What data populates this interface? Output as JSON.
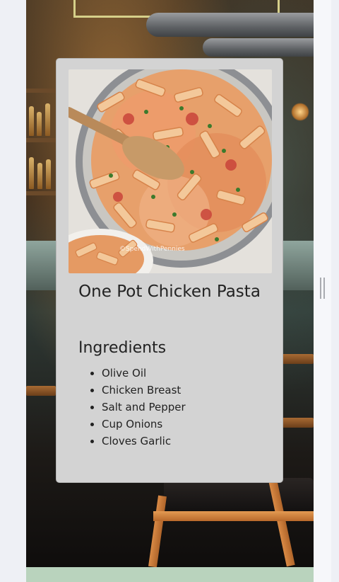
{
  "recipe": {
    "title": "One Pot Chicken Pasta",
    "image_watermark": "©SpendWithPennies",
    "ingredients_heading": "Ingredients",
    "ingredients": [
      "Olive Oil",
      "Chicken Breast",
      "Salt and Pepper",
      "Cup Onions",
      "Cloves Garlic"
    ]
  },
  "colors": {
    "card_background": "#d3d3d3",
    "page_background": "#eef0f5",
    "footer_strip": "#b9d3bd",
    "text": "#222222"
  },
  "icons": {
    "resize_handle": "vertical-grip-icon"
  }
}
